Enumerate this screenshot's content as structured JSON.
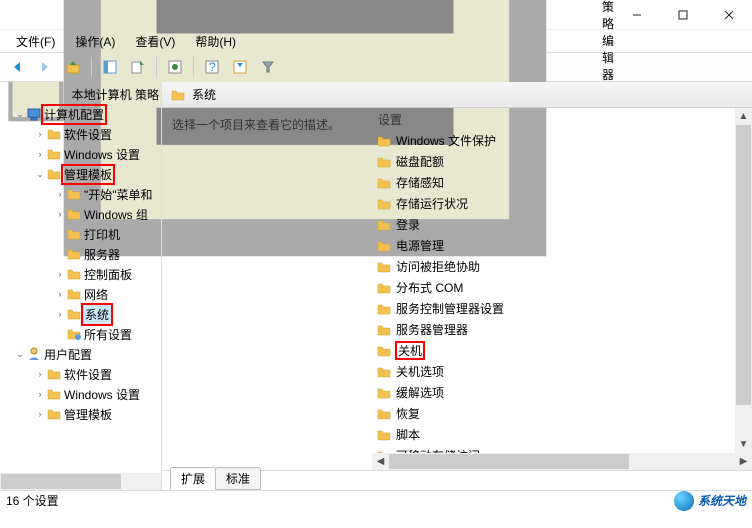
{
  "window": {
    "title": "本地组策略编辑器"
  },
  "menu": {
    "file": "文件(F)",
    "action": "操作(A)",
    "view": "查看(V)",
    "help": "帮助(H)"
  },
  "tree": {
    "root": "本地计算机 策略",
    "computer_config": "计算机配置",
    "software_settings": "软件设置",
    "windows_settings": "Windows 设置",
    "admin_templates": "管理模板",
    "start_menu": "\"开始\"菜单和",
    "windows_components": "Windows 组",
    "printers": "打印机",
    "server": "服务器",
    "control_panel": "控制面板",
    "network": "网络",
    "system": "系统",
    "all_settings": "所有设置",
    "user_config": "用户配置",
    "u_software": "软件设置",
    "u_windows": "Windows 设置",
    "u_admin": "管理模板"
  },
  "right": {
    "header": "系统",
    "desc": "选择一个项目来查看它的描述。",
    "settings_header": "设置",
    "items": [
      "Windows 文件保护",
      "磁盘配额",
      "存储感知",
      "存储运行状况",
      "登录",
      "电源管理",
      "访问被拒绝协助",
      "分布式 COM",
      "服务控制管理器设置",
      "服务器管理器",
      "关机",
      "关机选项",
      "缓解选项",
      "恢复",
      "脚本",
      "可移动存储访问"
    ]
  },
  "tabs": {
    "extended": "扩展",
    "standard": "标准"
  },
  "status": "16 个设置",
  "watermark": "系统天地"
}
